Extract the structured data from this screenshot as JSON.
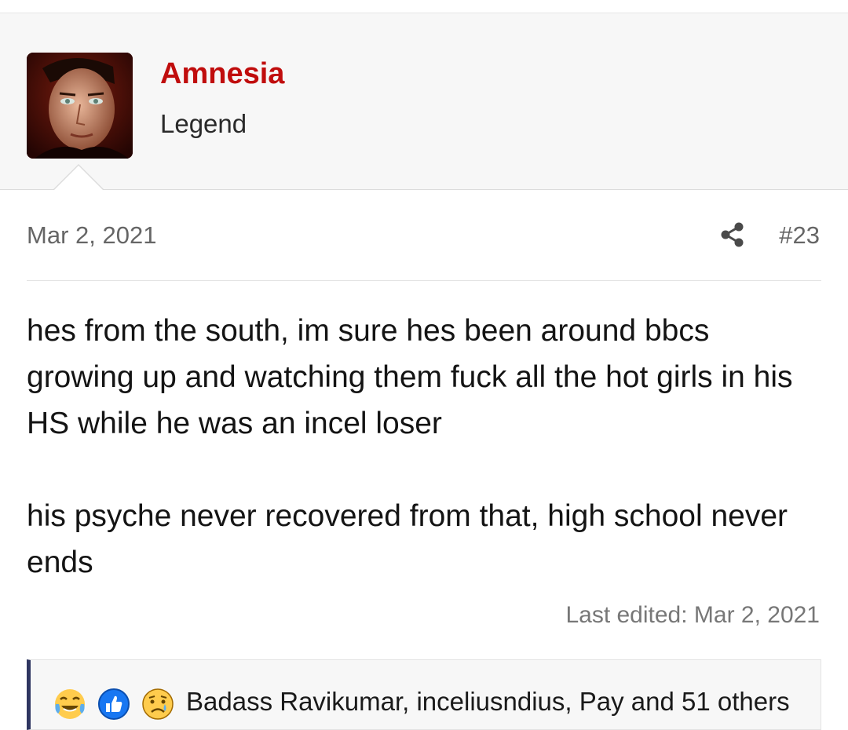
{
  "post": {
    "author": {
      "name": "Amnesia",
      "title": "Legend",
      "avatar_icon": "avatar-image"
    },
    "date": "Mar 2, 2021",
    "number": "#23",
    "share_icon": "share-icon",
    "body": {
      "paragraph_1": "hes from the south, im sure hes been around bbcs growing up and watching them fuck all the hot girls in his HS while he was an incel loser",
      "paragraph_2": "his psyche never recovered from that, high school never ends"
    },
    "last_edited": "Last edited: Mar 2, 2021",
    "reactions": {
      "icons": [
        "laughing-crying-icon",
        "thumbs-up-icon",
        "sad-icon"
      ],
      "text": "Badass Ravikumar, inceliusndius, Pay and 51 others"
    }
  },
  "colors": {
    "username": "#c00d0d",
    "reaction_bar_accent": "#2e3560",
    "header_background": "#f7f7f7"
  }
}
